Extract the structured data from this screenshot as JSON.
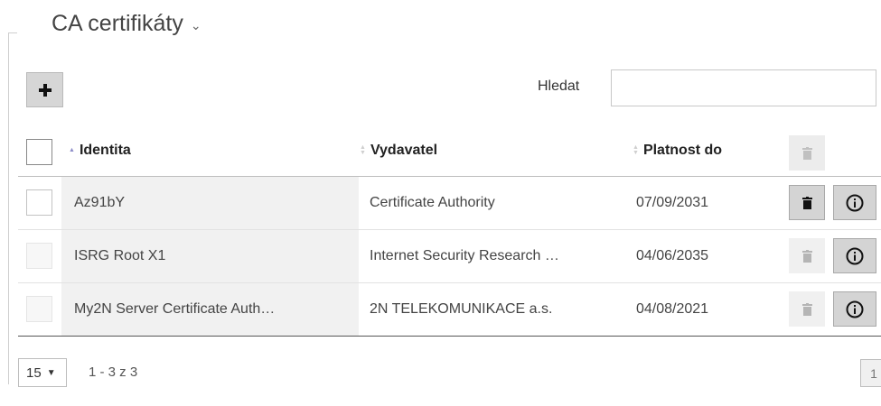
{
  "section": {
    "title": "CA certifikáty",
    "chevron": "⌄"
  },
  "toolbar": {
    "add_icon": "plus-icon",
    "search_label": "Hledat",
    "search_value": "",
    "search_placeholder": ""
  },
  "table": {
    "columns": [
      {
        "label": "Identita",
        "sorted": "asc"
      },
      {
        "label": "Vydavatel",
        "sorted": "none"
      },
      {
        "label": "Platnost do",
        "sorted": "none"
      }
    ],
    "rows": [
      {
        "identity": "Az91bY",
        "issuer": "Certificate Authority",
        "valid_until": "07/09/2031",
        "deletable": true
      },
      {
        "identity": "ISRG Root X1",
        "issuer": "Internet Security Research …",
        "valid_until": "04/06/2035",
        "deletable": false
      },
      {
        "identity": "My2N Server Certificate Auth…",
        "issuer": "2N TELEKOMUNIKACE a.s.",
        "valid_until": "04/08/2021",
        "deletable": false
      }
    ]
  },
  "footer": {
    "page_size": "15",
    "range": "1 - 3 z 3",
    "page": "1"
  },
  "colors": {
    "accent_sort": "#8c8cc8",
    "button_bg": "#d4d4d4"
  }
}
